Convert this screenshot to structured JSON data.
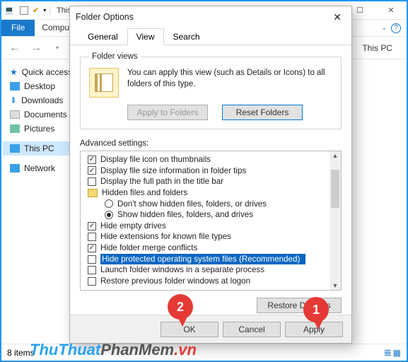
{
  "explorer": {
    "title": "This PC",
    "tabs": {
      "file": "File",
      "computer": "Computer"
    },
    "crumb": "This PC",
    "nav": {
      "quick": "Quick access",
      "desktop": "Desktop",
      "downloads": "Downloads",
      "documents": "Documents",
      "pictures": "Pictures",
      "thispc": "This PC",
      "network": "Network"
    },
    "status": "8 items"
  },
  "dialog": {
    "title": "Folder Options",
    "tabs": {
      "general": "General",
      "view": "View",
      "search": "Search"
    },
    "folderViews": {
      "legend": "Folder views",
      "desc": "You can apply this view (such as Details or Icons) to all folders of this type.",
      "applyBtn": "Apply to Folders",
      "resetBtn": "Reset Folders"
    },
    "advLabel": "Advanced settings:",
    "tree": {
      "r0": "Display file icon on thumbnails",
      "r1": "Display file size information in folder tips",
      "r2": "Display the full path in the title bar",
      "r3": "Hidden files and folders",
      "r4": "Don't show hidden files, folders, or drives",
      "r5": "Show hidden files, folders, and drives",
      "r6": "Hide empty drives",
      "r7": "Hide extensions for known file types",
      "r8": "Hide folder merge conflicts",
      "r9": "Hide protected operating system files (Recommended)",
      "r10": "Launch folder windows in a separate process",
      "r11": "Restore previous folder windows at logon"
    },
    "restoreBtn": "Restore Defaults",
    "footer": {
      "ok": "OK",
      "cancel": "Cancel",
      "apply": "Apply"
    }
  },
  "ann": {
    "m1": "1",
    "m2": "2"
  },
  "wm": {
    "a": "ThuThuat",
    "b": "PhanMem",
    "c": ".vn"
  }
}
